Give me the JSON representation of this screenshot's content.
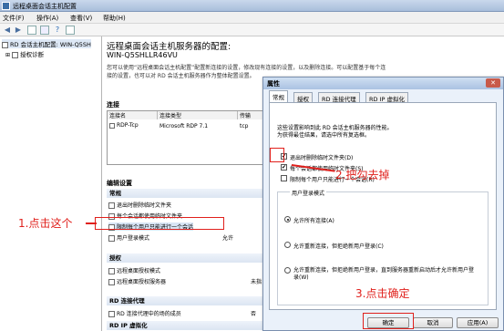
{
  "window": {
    "title": "远程桌面会话主机配置"
  },
  "menu": [
    "文件(F)",
    "操作(A)",
    "查看(V)",
    "帮助(H)"
  ],
  "tree": {
    "root": "RD 会话主机配置: WIN-Q5SH",
    "child": "授权诊断"
  },
  "content": {
    "title": "远程桌面会话主机服务器的配置:",
    "server": "WIN-Q5SHLLR46VU",
    "desc1": "您可以使用“远程桌面会话主机配置”配置新连接的设置，修改现有连接的设置，以及删除连接。可以配置基于每个连",
    "desc2": "接的设置，也可以对 RD 会话主机服务器作为整体配置设置。",
    "connections_label": "连接",
    "columns": [
      "连接名",
      "连接类型",
      "传输"
    ],
    "row": [
      "RDP-Tcp",
      "Microsoft RDP 7.1",
      "tcp"
    ],
    "edit_label": "编辑设置",
    "groups": {
      "general": "常规",
      "licensing": "授权",
      "broker": "RD 连接代理",
      "rdip": "RD IP 虚拟化"
    },
    "general_items": [
      "退出时删除临时文件夹",
      "每个会话都使用临时文件夹",
      "限制每个用户只能进行一个会话",
      "用户登录模式"
    ],
    "general_vals": [
      "",
      "",
      "",
      "允许"
    ],
    "licensing_items": [
      "远程桌面授权模式",
      "远程桌面授权服务器"
    ],
    "licensing_vals": [
      "",
      "未指"
    ],
    "broker_items": [
      "RD 连接代理中的场的成员"
    ],
    "broker_vals": [
      "否"
    ]
  },
  "dialog": {
    "title": "属性",
    "tabs": [
      "常规",
      "授权",
      "RD 连接代理",
      "RD IP 虚拟化"
    ],
    "intro1": "这些设置影响到此 RD 会话主机服务器的性能。",
    "intro2": "为获得最佳结果，请选中所有复选框。",
    "options": [
      "退出时删除临时文件夹(D)",
      "每个会话都使用临时文件夹(S)",
      "限制每个用户只能进行一个会话(R)"
    ],
    "options_checked": [
      true,
      true,
      false
    ],
    "logon_group": "用户登录模式",
    "radios": [
      "允许所有连接(A)",
      "允许重新连接，但拒绝新用户登录(C)",
      "允许重新连接，但拒绝新用户登录，直到服务器重新启动后才允许新用户登录(W)"
    ],
    "radio_selected": 0,
    "buttons": {
      "ok": "确定",
      "cancel": "取消",
      "apply": "应用(A)"
    }
  },
  "annotations": {
    "step1": "1.点击这个",
    "step2": "2.把勾去掉",
    "step3": "3.点击确定"
  },
  "colors": {
    "annotation": "#e0201c",
    "titlebar": "#a9bedb"
  }
}
